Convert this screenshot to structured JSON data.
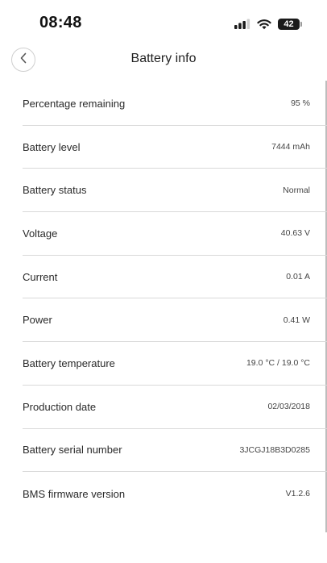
{
  "status_bar": {
    "time": "08:48",
    "battery_level": "42",
    "icons": [
      "signal-icon",
      "wifi-icon",
      "battery-icon"
    ]
  },
  "header": {
    "title": "Battery info",
    "back_icon": "chevron-left-icon"
  },
  "rows": [
    {
      "label": "Percentage remaining",
      "value": "95 %"
    },
    {
      "label": "Battery level",
      "value": "7444 mAh"
    },
    {
      "label": "Battery status",
      "value": "Normal"
    },
    {
      "label": "Voltage",
      "value": "40.63 V"
    },
    {
      "label": "Current",
      "value": "0.01 A"
    },
    {
      "label": "Power",
      "value": "0.41 W"
    },
    {
      "label": "Battery temperature",
      "value": "19.0 °C / 19.0 °C"
    },
    {
      "label": "Production date",
      "value": "02/03/2018"
    },
    {
      "label": "Battery serial number",
      "value": "3JCGJ18B3D0285"
    },
    {
      "label": "BMS firmware version",
      "value": "V1.2.6"
    }
  ]
}
